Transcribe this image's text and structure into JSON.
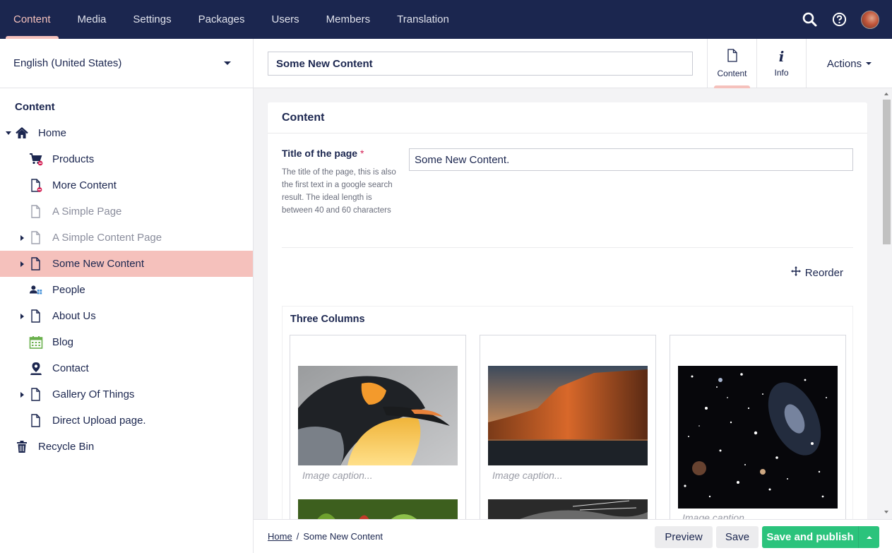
{
  "topnav": {
    "items": [
      {
        "label": "Content",
        "active": true
      },
      {
        "label": "Media"
      },
      {
        "label": "Settings"
      },
      {
        "label": "Packages"
      },
      {
        "label": "Users"
      },
      {
        "label": "Members"
      },
      {
        "label": "Translation"
      }
    ],
    "icons": [
      "search-icon",
      "help-icon",
      "user-avatar"
    ]
  },
  "sidebar": {
    "language": "English (United States)",
    "section_title": "Content",
    "tree": [
      {
        "label": "Home",
        "icon": "home-icon",
        "expanded": true
      },
      {
        "label": "Products",
        "icon": "cart-icon"
      },
      {
        "label": "More Content",
        "icon": "document-icon"
      },
      {
        "label": "A Simple Page",
        "icon": "document-icon",
        "unpublished": true
      },
      {
        "label": "A Simple Content Page",
        "icon": "document-icon",
        "unpublished": true,
        "has_children": true
      },
      {
        "label": "Some New Content",
        "icon": "document-icon",
        "selected": true,
        "has_children": true
      },
      {
        "label": "People",
        "icon": "people-icon"
      },
      {
        "label": "About Us",
        "icon": "document-icon",
        "has_children": true
      },
      {
        "label": "Blog",
        "icon": "calendar-icon"
      },
      {
        "label": "Contact",
        "icon": "map-pin-icon"
      },
      {
        "label": "Gallery Of Things",
        "icon": "document-icon",
        "has_children": true
      },
      {
        "label": "Direct Upload page.",
        "icon": "document-icon"
      },
      {
        "label": "Recycle Bin",
        "icon": "trash-icon"
      }
    ]
  },
  "editor": {
    "name": "Some New Content",
    "apps": [
      {
        "label": "Content",
        "icon": "document-icon",
        "active": true
      },
      {
        "label": "Info",
        "icon": "info-icon"
      }
    ],
    "actions_label": "Actions",
    "group_title": "Content",
    "property": {
      "label": "Title of the page",
      "required_marker": "*",
      "description": "The title of the page, this is also the first text in a google search result. The ideal length is between 40 and 60 characters",
      "value": "Some New Content."
    },
    "reorder_label": "Reorder",
    "block": {
      "title": "Three Columns",
      "columns": [
        {
          "image": "penguin-image",
          "caption_placeholder": "Image caption..."
        },
        {
          "image": "cliff-sunset-image",
          "caption_placeholder": "Image caption..."
        },
        {
          "image": "galaxy-image",
          "caption_placeholder": "Image caption..."
        }
      ]
    }
  },
  "footer": {
    "breadcrumb": [
      "Home",
      "Some New Content"
    ],
    "breadcrumb_separator": "/",
    "preview_label": "Preview",
    "save_label": "Save",
    "publish_label": "Save and publish"
  },
  "colors": {
    "nav_bg": "#1b264f",
    "accent": "#f5c1bc",
    "publish": "#2bc37c",
    "text": "#1b264f"
  }
}
